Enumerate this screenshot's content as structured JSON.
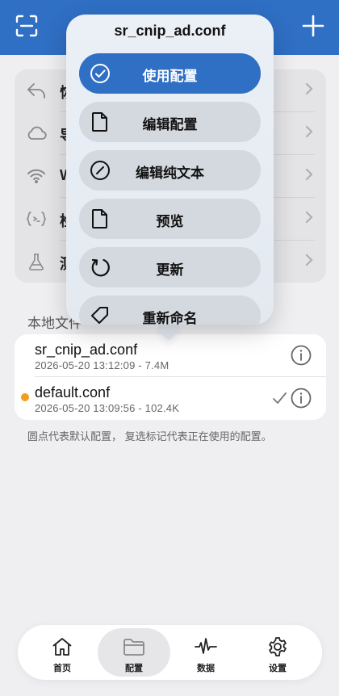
{
  "header": {
    "scan_icon": "scan-icon",
    "add_icon": "plus-icon",
    "accent": "#2f6fc4"
  },
  "background_list": {
    "items": [
      {
        "icon": "restore-icon",
        "label": "恢"
      },
      {
        "icon": "cloud-icon",
        "label": "导"
      },
      {
        "icon": "wifi-icon",
        "label": "W"
      },
      {
        "icon": "script-icon",
        "label": "检"
      },
      {
        "icon": "flask-icon",
        "label": "测"
      }
    ]
  },
  "files": {
    "section_title": "本地文件",
    "items": [
      {
        "name": "sr_cnip_ad.conf",
        "meta": "2026-05-20 13:12:09 - 7.4M",
        "is_default": false,
        "in_use": false
      },
      {
        "name": "default.conf",
        "meta": "2026-05-20 13:09:56 - 102.4K",
        "is_default": true,
        "in_use": true
      }
    ],
    "footnote": "圆点代表默认配置， 复选标记代表正在使用的配置。",
    "default_dot_color": "#f29d1b"
  },
  "popup": {
    "title": "sr_cnip_ad.conf",
    "items": [
      {
        "icon": "checkmark-circle-icon",
        "label": "使用配置",
        "active": true
      },
      {
        "icon": "document-icon",
        "label": "编辑配置",
        "active": false
      },
      {
        "icon": "slash-circle-icon",
        "label": "编辑纯文本",
        "active": false
      },
      {
        "icon": "document-icon",
        "label": "预览",
        "active": false
      },
      {
        "icon": "refresh-icon",
        "label": "更新",
        "active": false
      },
      {
        "icon": "tag-icon",
        "label": "重新命名",
        "active": false
      }
    ]
  },
  "tabbar": {
    "tabs": [
      {
        "icon": "home-icon",
        "label": "首页",
        "active": false
      },
      {
        "icon": "folder-icon",
        "label": "配置",
        "active": true
      },
      {
        "icon": "waveform-icon",
        "label": "数据",
        "active": false
      },
      {
        "icon": "gear-icon",
        "label": "设置",
        "active": false
      }
    ]
  }
}
